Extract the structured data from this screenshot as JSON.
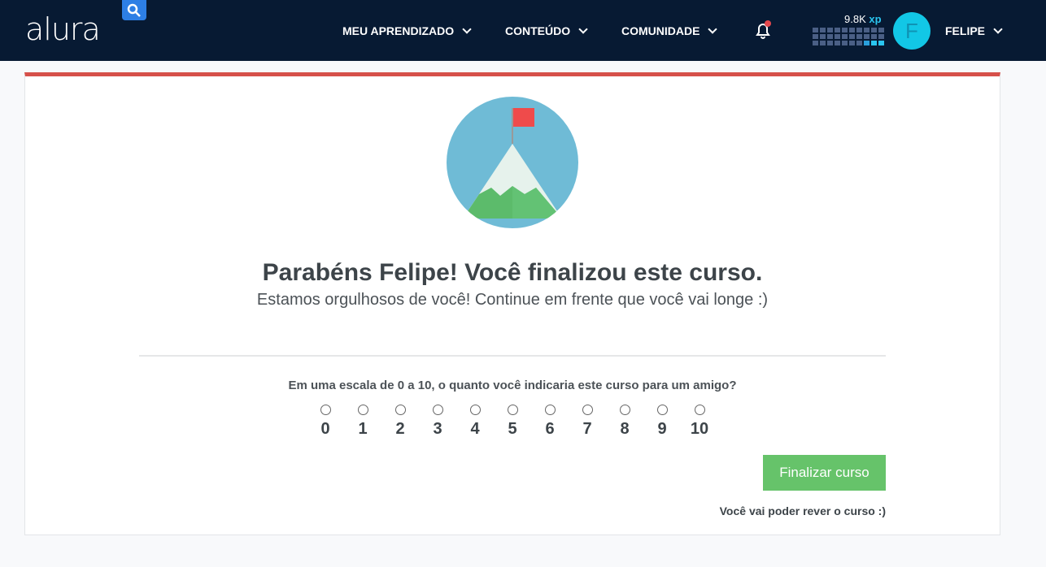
{
  "header": {
    "logo": "alura",
    "nav": [
      {
        "label": "MEU APRENDIZADO"
      },
      {
        "label": "CONTEÚDO"
      },
      {
        "label": "COMUNIDADE"
      }
    ],
    "xp": "9.8K",
    "xp_unit": "xp",
    "avatar_letter": "F",
    "user": "FELIPE"
  },
  "main": {
    "title": "Parabéns Felipe! Você finalizou este curso.",
    "subtitle": "Estamos orgulhosos de você! Continue em frente que você vai longe :)",
    "question": "Em uma escala de 0 a 10, o quanto você indicaria este curso para um amigo?",
    "scale": [
      "0",
      "1",
      "2",
      "3",
      "4",
      "5",
      "6",
      "7",
      "8",
      "9",
      "10"
    ],
    "finish_button": "Finalizar curso",
    "note": "Você vai poder rever o curso :)"
  },
  "colors": {
    "header_bg": "#071a33",
    "accent_red": "#d6504a",
    "button_green": "#66c36a",
    "avatar": "#12c7e6"
  }
}
